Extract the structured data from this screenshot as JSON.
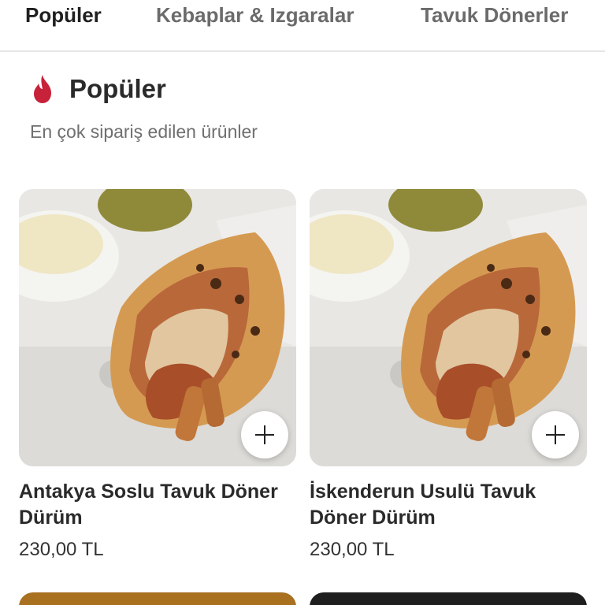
{
  "tabs": [
    {
      "label": "Popüler",
      "active": true
    },
    {
      "label": "Kebaplar & Izgaralar",
      "active": false
    },
    {
      "label": "Tavuk Dönerler",
      "active": false
    }
  ],
  "section": {
    "icon": "flame-icon",
    "title": "Popüler",
    "subtitle": "En çok sipariş edilen ürünler"
  },
  "products": [
    {
      "name": "Antakya Soslu Tavuk Döner Dürüm",
      "price": "230,00 TL",
      "image": "chicken-doner-wrap",
      "add_icon": "plus-icon"
    },
    {
      "name": "İskenderun Usulü Tavuk Döner Dürüm",
      "price": "230,00 TL",
      "image": "chicken-doner-wrap",
      "add_icon": "plus-icon"
    }
  ],
  "colors": {
    "accent_flame": "#c8213a",
    "active_tab": "#1f1f1f",
    "inactive_tab": "#6b6b6b"
  }
}
